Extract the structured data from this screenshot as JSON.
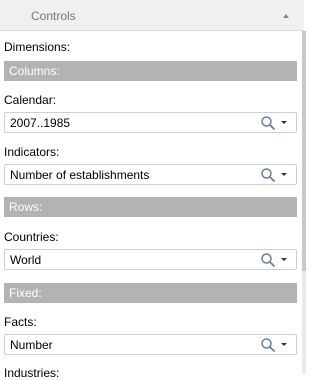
{
  "panel": {
    "title": "Controls"
  },
  "dimensions_label": "Dimensions:",
  "sections": {
    "columns": "Columns:",
    "rows": "Rows:",
    "fixed": "Fixed:"
  },
  "fields": {
    "calendar": {
      "label": "Calendar:",
      "value": "2007..1985"
    },
    "indicators": {
      "label": "Indicators:",
      "value": "Number of establishments"
    },
    "countries": {
      "label": "Countries:",
      "value": "World"
    },
    "facts": {
      "label": "Facts:",
      "value": "Number"
    },
    "industries": {
      "label": "Industries:"
    }
  },
  "icons": {
    "search": "search-icon",
    "dropdown": "chevron-down-icon",
    "collapse": "chevron-up-icon"
  }
}
